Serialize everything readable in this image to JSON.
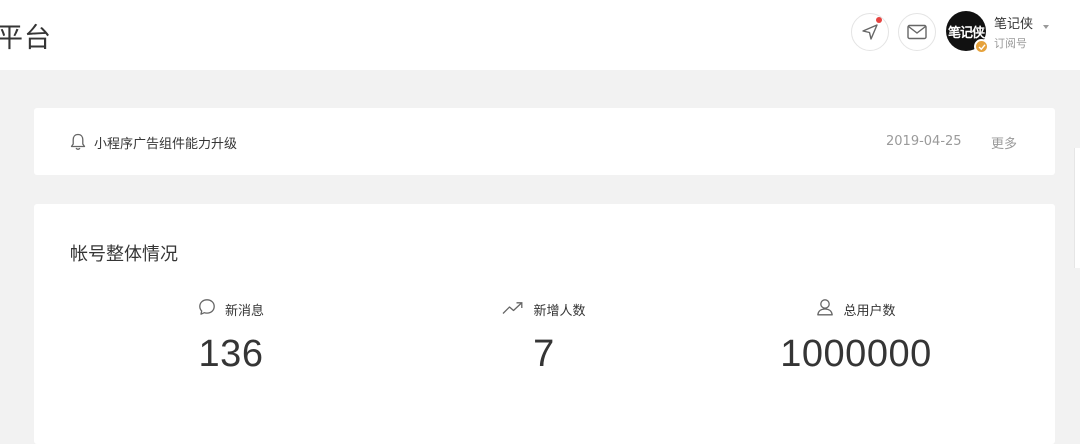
{
  "header": {
    "brand_title": "平台",
    "account": {
      "avatar_text": "笔记侠",
      "name": "笔记侠",
      "type": "订阅号"
    },
    "icons": {
      "location": "navigation-arrow-icon",
      "mail": "mail-icon",
      "notification_dot_color": "#e64340"
    }
  },
  "notice": {
    "text": "小程序广告组件能力升级",
    "date": "2019-04-25",
    "more_label": "更多"
  },
  "overview": {
    "title": "帐号整体情况",
    "stats": [
      {
        "label": "新消息",
        "value": "136",
        "icon": "chat-bubble-icon"
      },
      {
        "label": "新增人数",
        "value": "7",
        "icon": "trend-up-icon"
      },
      {
        "label": "总用户数",
        "value": "1000000",
        "icon": "user-icon"
      }
    ]
  },
  "colors": {
    "page_bg": "#f2f2f2",
    "card_bg": "#ffffff",
    "text": "#353535",
    "muted": "#9a9a9a",
    "badge": "#e6a23c"
  }
}
